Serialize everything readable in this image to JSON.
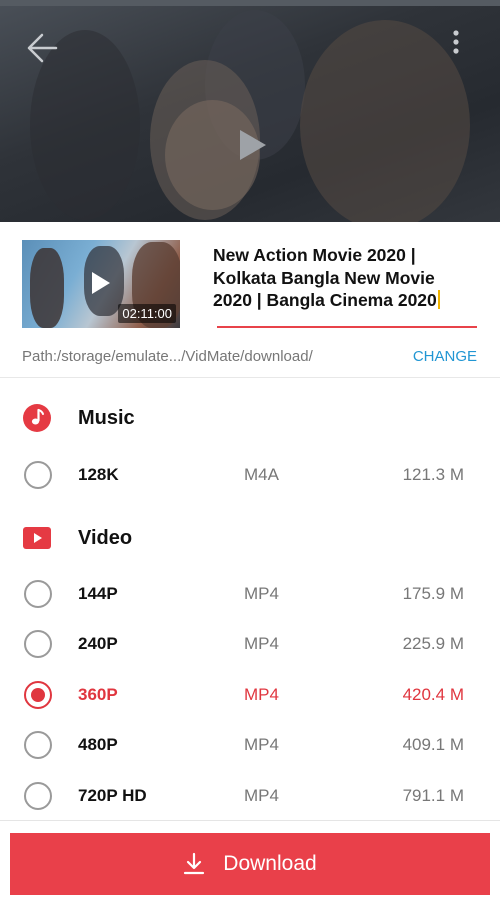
{
  "player": {
    "back_icon": "back-arrow-icon",
    "more_icon": "more-vertical-icon",
    "play_icon": "play-icon"
  },
  "video": {
    "title": "New Action Movie 2020 | Kolkata Bangla New Movie 2020 | Bangla Cinema 2020",
    "duration": "02:11:00"
  },
  "path": {
    "text": "Path:/storage/emulate.../VidMate/download/",
    "change_label": "CHANGE"
  },
  "music": {
    "label": "Music",
    "options": [
      {
        "quality": "128K",
        "format": "M4A",
        "size": "121.3 M",
        "selected": false
      }
    ]
  },
  "video_section": {
    "label": "Video",
    "options": [
      {
        "quality": "144P",
        "format": "MP4",
        "size": "175.9 M",
        "selected": false
      },
      {
        "quality": "240P",
        "format": "MP4",
        "size": "225.9 M",
        "selected": false
      },
      {
        "quality": "360P",
        "format": "MP4",
        "size": "420.4 M",
        "selected": true
      },
      {
        "quality": "480P",
        "format": "MP4",
        "size": "409.1 M",
        "selected": false
      },
      {
        "quality": "720P HD",
        "format": "MP4",
        "size": "791.1 M",
        "selected": false
      }
    ]
  },
  "download": {
    "label": "Download"
  },
  "colors": {
    "accent": "#e9404a",
    "link": "#2196d3",
    "muted": "#777777"
  }
}
